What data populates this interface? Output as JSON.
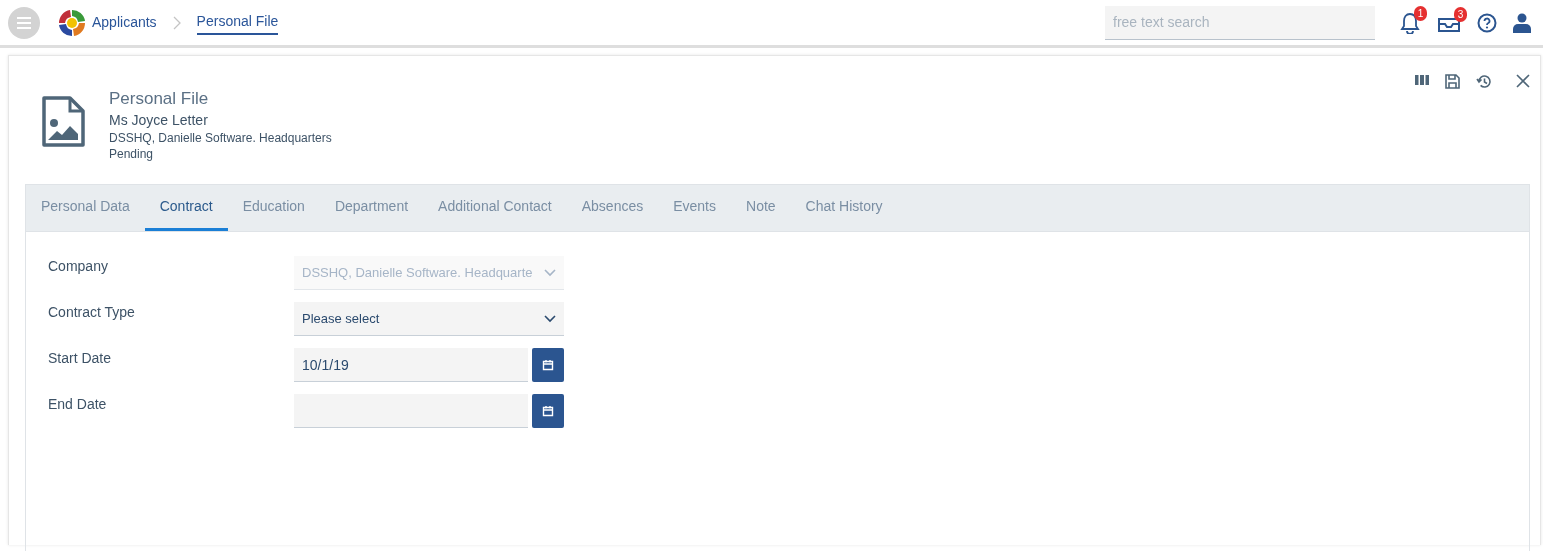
{
  "breadcrumb": [
    {
      "label": "Applicants",
      "current": false
    },
    {
      "label": "Personal File",
      "current": true
    }
  ],
  "search": {
    "placeholder": "free text search"
  },
  "notifications": {
    "badge": "1"
  },
  "messages": {
    "badge": "3"
  },
  "record": {
    "title": "Personal File",
    "name": "Ms Joyce Letter",
    "company": "DSSHQ, Danielle Software. Headquarters",
    "status": "Pending"
  },
  "tabs": [
    {
      "label": "Personal Data",
      "selected": false
    },
    {
      "label": "Contract",
      "selected": true
    },
    {
      "label": "Education",
      "selected": false
    },
    {
      "label": "Department",
      "selected": false
    },
    {
      "label": "Additional Contact",
      "selected": false
    },
    {
      "label": "Absences",
      "selected": false
    },
    {
      "label": "Events",
      "selected": false
    },
    {
      "label": "Note",
      "selected": false
    },
    {
      "label": "Chat History",
      "selected": false
    }
  ],
  "fields": [
    {
      "label": "Company",
      "kind": "select",
      "value": "DSSHQ, Danielle Software. Headquarte",
      "disabled": true
    },
    {
      "label": "Contract Type",
      "kind": "select",
      "value": "Please select",
      "disabled": false
    },
    {
      "label": "Start Date",
      "kind": "date",
      "value": "10/1/19"
    },
    {
      "label": "End Date",
      "kind": "date"
    }
  ]
}
